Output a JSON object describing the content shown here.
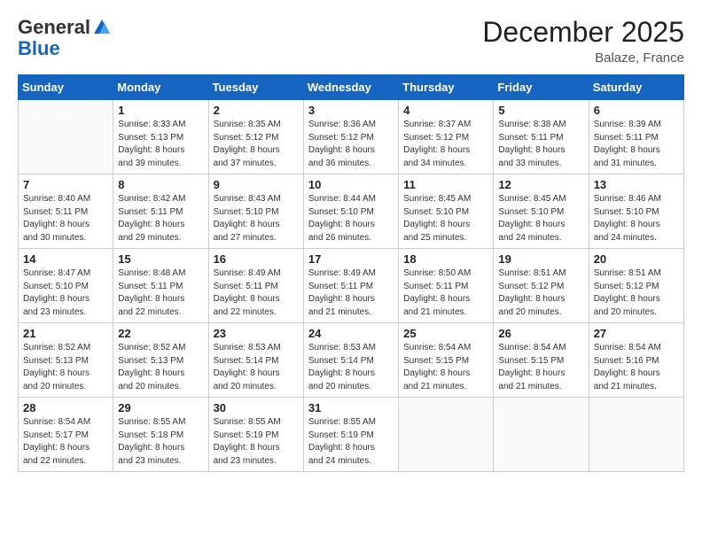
{
  "logo": {
    "general": "General",
    "blue": "Blue"
  },
  "title": "December 2025",
  "subtitle": "Balaze, France",
  "days_of_week": [
    "Sunday",
    "Monday",
    "Tuesday",
    "Wednesday",
    "Thursday",
    "Friday",
    "Saturday"
  ],
  "weeks": [
    [
      {
        "day": "",
        "info": ""
      },
      {
        "day": "1",
        "info": "Sunrise: 8:33 AM\nSunset: 5:13 PM\nDaylight: 8 hours\nand 39 minutes."
      },
      {
        "day": "2",
        "info": "Sunrise: 8:35 AM\nSunset: 5:12 PM\nDaylight: 8 hours\nand 37 minutes."
      },
      {
        "day": "3",
        "info": "Sunrise: 8:36 AM\nSunset: 5:12 PM\nDaylight: 8 hours\nand 36 minutes."
      },
      {
        "day": "4",
        "info": "Sunrise: 8:37 AM\nSunset: 5:12 PM\nDaylight: 8 hours\nand 34 minutes."
      },
      {
        "day": "5",
        "info": "Sunrise: 8:38 AM\nSunset: 5:11 PM\nDaylight: 8 hours\nand 33 minutes."
      },
      {
        "day": "6",
        "info": "Sunrise: 8:39 AM\nSunset: 5:11 PM\nDaylight: 8 hours\nand 31 minutes."
      }
    ],
    [
      {
        "day": "7",
        "info": "Sunrise: 8:40 AM\nSunset: 5:11 PM\nDaylight: 8 hours\nand 30 minutes."
      },
      {
        "day": "8",
        "info": "Sunrise: 8:42 AM\nSunset: 5:11 PM\nDaylight: 8 hours\nand 29 minutes."
      },
      {
        "day": "9",
        "info": "Sunrise: 8:43 AM\nSunset: 5:10 PM\nDaylight: 8 hours\nand 27 minutes."
      },
      {
        "day": "10",
        "info": "Sunrise: 8:44 AM\nSunset: 5:10 PM\nDaylight: 8 hours\nand 26 minutes."
      },
      {
        "day": "11",
        "info": "Sunrise: 8:45 AM\nSunset: 5:10 PM\nDaylight: 8 hours\nand 25 minutes."
      },
      {
        "day": "12",
        "info": "Sunrise: 8:45 AM\nSunset: 5:10 PM\nDaylight: 8 hours\nand 24 minutes."
      },
      {
        "day": "13",
        "info": "Sunrise: 8:46 AM\nSunset: 5:10 PM\nDaylight: 8 hours\nand 24 minutes."
      }
    ],
    [
      {
        "day": "14",
        "info": "Sunrise: 8:47 AM\nSunset: 5:10 PM\nDaylight: 8 hours\nand 23 minutes."
      },
      {
        "day": "15",
        "info": "Sunrise: 8:48 AM\nSunset: 5:11 PM\nDaylight: 8 hours\nand 22 minutes."
      },
      {
        "day": "16",
        "info": "Sunrise: 8:49 AM\nSunset: 5:11 PM\nDaylight: 8 hours\nand 22 minutes."
      },
      {
        "day": "17",
        "info": "Sunrise: 8:49 AM\nSunset: 5:11 PM\nDaylight: 8 hours\nand 21 minutes."
      },
      {
        "day": "18",
        "info": "Sunrise: 8:50 AM\nSunset: 5:11 PM\nDaylight: 8 hours\nand 21 minutes."
      },
      {
        "day": "19",
        "info": "Sunrise: 8:51 AM\nSunset: 5:12 PM\nDaylight: 8 hours\nand 20 minutes."
      },
      {
        "day": "20",
        "info": "Sunrise: 8:51 AM\nSunset: 5:12 PM\nDaylight: 8 hours\nand 20 minutes."
      }
    ],
    [
      {
        "day": "21",
        "info": "Sunrise: 8:52 AM\nSunset: 5:13 PM\nDaylight: 8 hours\nand 20 minutes."
      },
      {
        "day": "22",
        "info": "Sunrise: 8:52 AM\nSunset: 5:13 PM\nDaylight: 8 hours\nand 20 minutes."
      },
      {
        "day": "23",
        "info": "Sunrise: 8:53 AM\nSunset: 5:14 PM\nDaylight: 8 hours\nand 20 minutes."
      },
      {
        "day": "24",
        "info": "Sunrise: 8:53 AM\nSunset: 5:14 PM\nDaylight: 8 hours\nand 20 minutes."
      },
      {
        "day": "25",
        "info": "Sunrise: 8:54 AM\nSunset: 5:15 PM\nDaylight: 8 hours\nand 21 minutes."
      },
      {
        "day": "26",
        "info": "Sunrise: 8:54 AM\nSunset: 5:15 PM\nDaylight: 8 hours\nand 21 minutes."
      },
      {
        "day": "27",
        "info": "Sunrise: 8:54 AM\nSunset: 5:16 PM\nDaylight: 8 hours\nand 21 minutes."
      }
    ],
    [
      {
        "day": "28",
        "info": "Sunrise: 8:54 AM\nSunset: 5:17 PM\nDaylight: 8 hours\nand 22 minutes."
      },
      {
        "day": "29",
        "info": "Sunrise: 8:55 AM\nSunset: 5:18 PM\nDaylight: 8 hours\nand 23 minutes."
      },
      {
        "day": "30",
        "info": "Sunrise: 8:55 AM\nSunset: 5:19 PM\nDaylight: 8 hours\nand 23 minutes."
      },
      {
        "day": "31",
        "info": "Sunrise: 8:55 AM\nSunset: 5:19 PM\nDaylight: 8 hours\nand 24 minutes."
      },
      {
        "day": "",
        "info": ""
      },
      {
        "day": "",
        "info": ""
      },
      {
        "day": "",
        "info": ""
      }
    ]
  ]
}
